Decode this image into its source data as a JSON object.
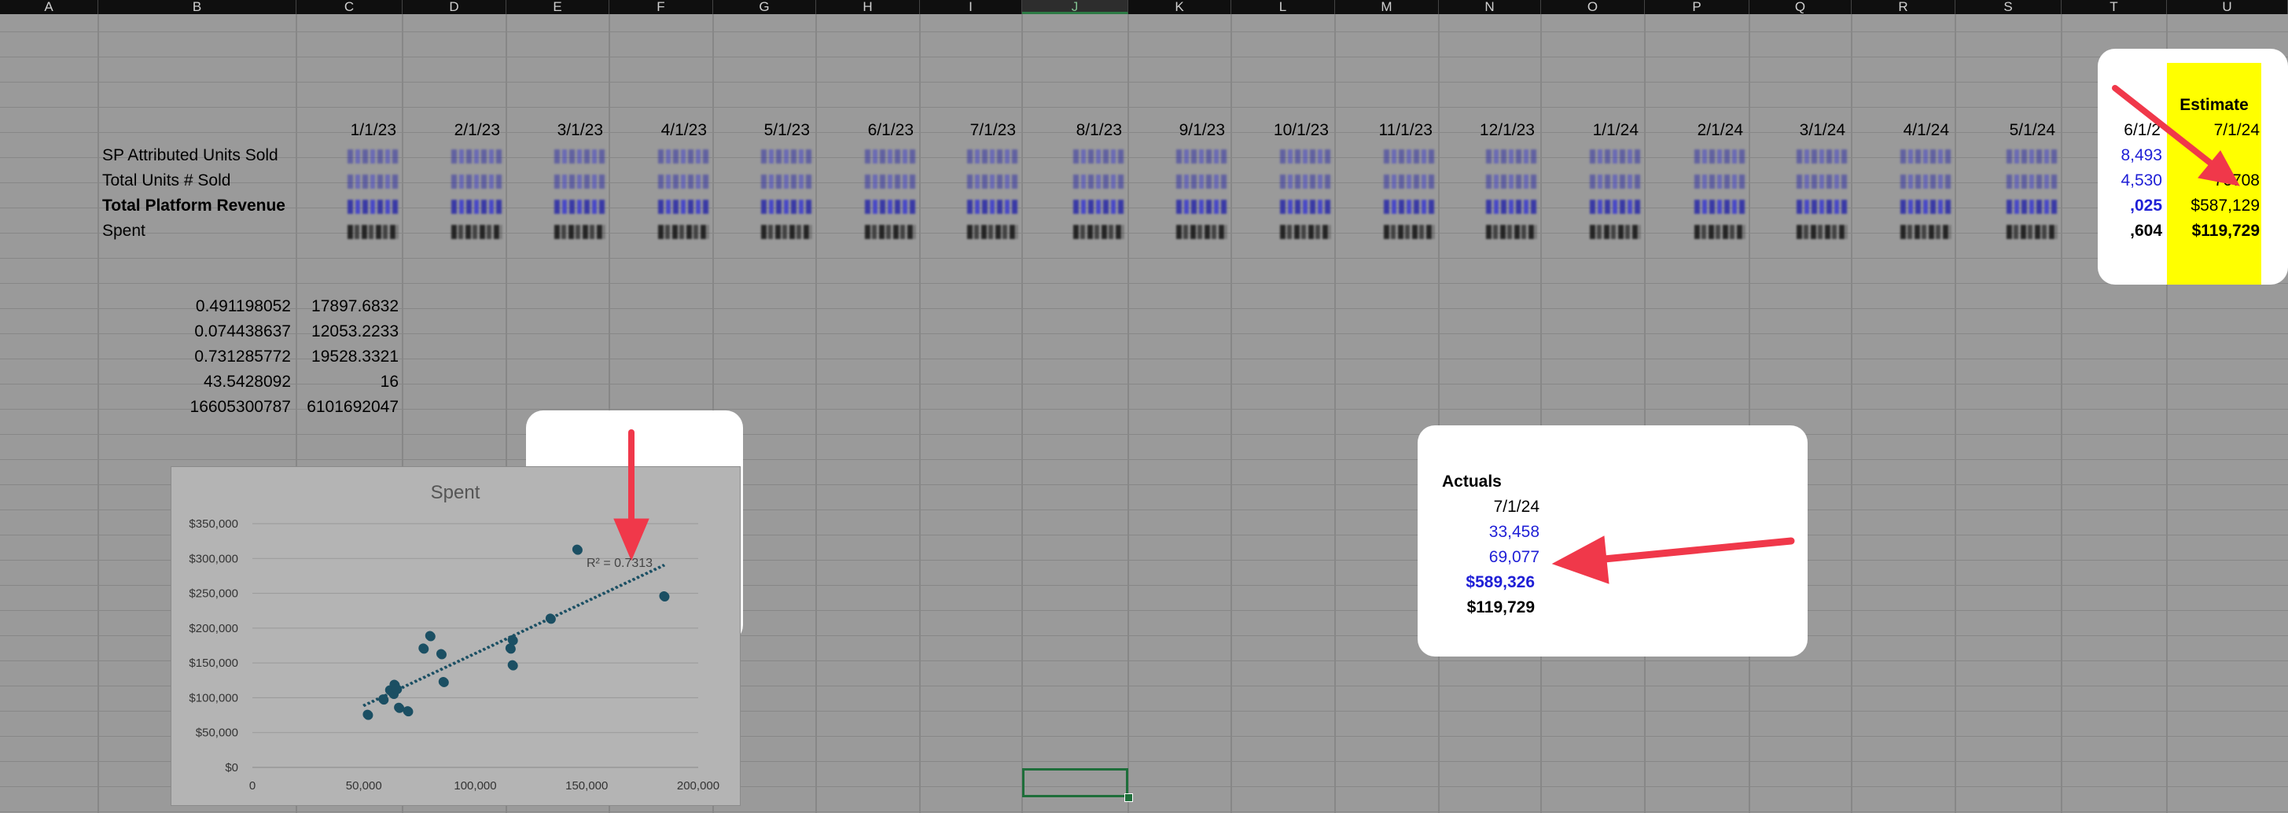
{
  "columns": [
    "A",
    "B",
    "C",
    "D",
    "E",
    "F",
    "G",
    "H",
    "I",
    "J",
    "K",
    "L",
    "M",
    "N",
    "O",
    "P",
    "Q",
    "R",
    "S",
    "T",
    "U"
  ],
  "selected_column": "J",
  "dates": [
    "1/1/23",
    "2/1/23",
    "3/1/23",
    "4/1/23",
    "5/1/23",
    "6/1/23",
    "7/1/23",
    "8/1/23",
    "9/1/23",
    "10/1/23",
    "11/1/23",
    "12/1/23",
    "1/1/24",
    "2/1/24",
    "3/1/24",
    "4/1/24",
    "5/1/24",
    "6/1/2"
  ],
  "row_labels": {
    "sp_units": "SP Attributed Units Sold",
    "total_units": "Total Units # Sold",
    "revenue": "Total Platform Revenue",
    "spent": "Spent"
  },
  "t_column_partial": {
    "sp_units": "8,493",
    "total_units": "4,530",
    "revenue": ",025",
    "spent": ",604"
  },
  "estimate": {
    "header": "Estimate",
    "date": "7/1/24",
    "total_units": "76708",
    "revenue": "$587,129",
    "spent": "$119,729"
  },
  "regression": {
    "b_values": [
      "0.491198052",
      "0.074438637",
      "0.731285772",
      "43.5428092",
      "16605300787"
    ],
    "c_values": [
      "17897.6832",
      "12053.2233",
      "19528.3321",
      "16",
      "6101692047"
    ]
  },
  "actuals": {
    "header": "Actuals",
    "date": "7/1/24",
    "sp_units": "33,458",
    "total_units": "69,077",
    "revenue": "$589,326",
    "spent": "$119,729"
  },
  "colors": {
    "blue_text": "#1f1fd6",
    "yellow": "#ffff00",
    "arrow": "#f0384a",
    "marker": "#1b4f63"
  },
  "chart_data": {
    "type": "scatter",
    "title": "Spent",
    "xlabel": "",
    "ylabel": "",
    "xlim": [
      0,
      200000
    ],
    "ylim": [
      0,
      350000
    ],
    "x_ticks": [
      "0",
      "50,000",
      "100,000",
      "150,000",
      "200,000"
    ],
    "y_ticks": [
      "$0",
      "$50,000",
      "$100,000",
      "$150,000",
      "$200,000",
      "$250,000",
      "$300,000",
      "$350,000"
    ],
    "trendline": {
      "type": "linear",
      "label": "R² = 0.7313",
      "from": [
        50000,
        88000
      ],
      "to": [
        185000,
        290000
      ]
    },
    "points": [
      {
        "x": 52000,
        "y": 75000
      },
      {
        "x": 59000,
        "y": 97000
      },
      {
        "x": 62000,
        "y": 110000
      },
      {
        "x": 63500,
        "y": 105000
      },
      {
        "x": 64000,
        "y": 118000
      },
      {
        "x": 65000,
        "y": 112000
      },
      {
        "x": 66000,
        "y": 85000
      },
      {
        "x": 70000,
        "y": 80000
      },
      {
        "x": 77000,
        "y": 170000
      },
      {
        "x": 80000,
        "y": 188000
      },
      {
        "x": 85000,
        "y": 162000
      },
      {
        "x": 86000,
        "y": 122000
      },
      {
        "x": 116000,
        "y": 170000
      },
      {
        "x": 117000,
        "y": 182000
      },
      {
        "x": 117000,
        "y": 146000
      },
      {
        "x": 134000,
        "y": 213000
      },
      {
        "x": 146000,
        "y": 312000
      },
      {
        "x": 185000,
        "y": 245000
      }
    ]
  }
}
